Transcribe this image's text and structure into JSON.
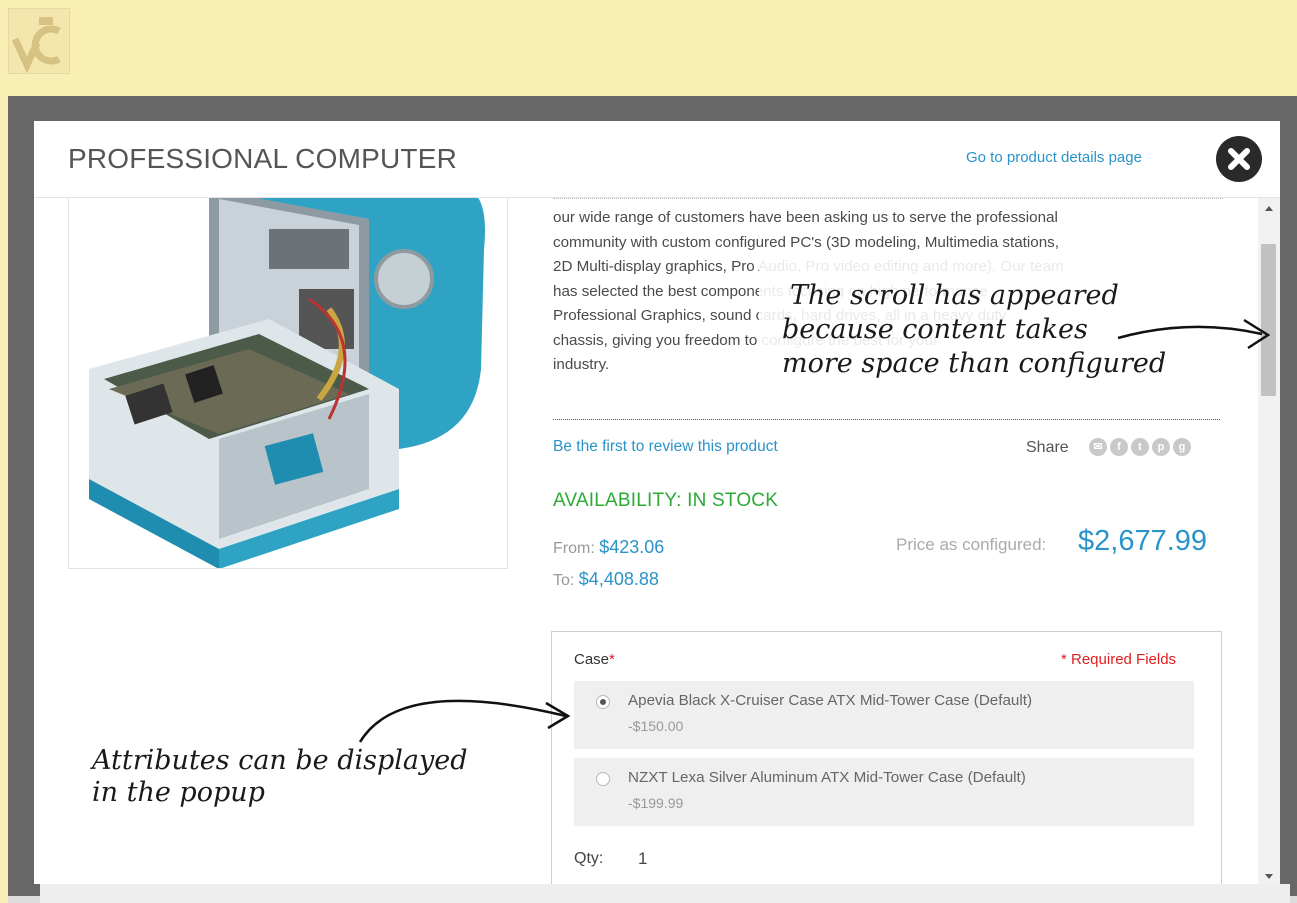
{
  "popup": {
    "title": "PROFESSIONAL COMPUTER",
    "details_link": "Go to product details page"
  },
  "product": {
    "description_lines": [
      "our wide range of customers have been asking us to serve the professional",
      "community with custom configured PC's (3D modeling, Multimedia stations,",
      "2D Multi-display graphics, Pro Audio, Pro video editing and more). Our team",
      "has selected the best components focusing on high performance",
      "Professional Graphics, sound cards, hard drives, all in a heavy duty",
      "chassis, giving you freedom to configure the best for your",
      "industry."
    ],
    "review_link": "Be the first to review this product",
    "share_label": "Share",
    "share_icons": [
      "email-icon",
      "facebook-icon",
      "twitter-icon",
      "pinterest-icon",
      "google-plus-icon"
    ],
    "availability": "AVAILABILITY: IN STOCK",
    "from_label": "From:",
    "from_price": "$423.06",
    "to_label": "To:",
    "to_price": "$4,408.88",
    "configured_label": "Price as configured:",
    "configured_price": "$2,677.99"
  },
  "options": {
    "case_label": "Case",
    "required_star": "*",
    "required_note": "* Required Fields",
    "items": [
      {
        "name": "Apevia Black X-Cruiser Case ATX Mid-Tower Case (Default)",
        "price": "-$150.00",
        "selected": true
      },
      {
        "name": "NZXT Lexa Silver Aluminum ATX Mid-Tower Case (Default)",
        "price": "-$199.99",
        "selected": false
      }
    ],
    "qty_label": "Qty:",
    "qty_value": "1"
  },
  "annotations": {
    "scroll_note": [
      "The scroll has appeared",
      "because content takes",
      "more space than configured"
    ],
    "attributes_note": [
      "Attributes can be displayed",
      "in the popup"
    ]
  },
  "colors": {
    "accent": "#2a93c9",
    "in_stock": "#2bab34",
    "required": "#e02020",
    "page_background": "#f9efb5"
  }
}
